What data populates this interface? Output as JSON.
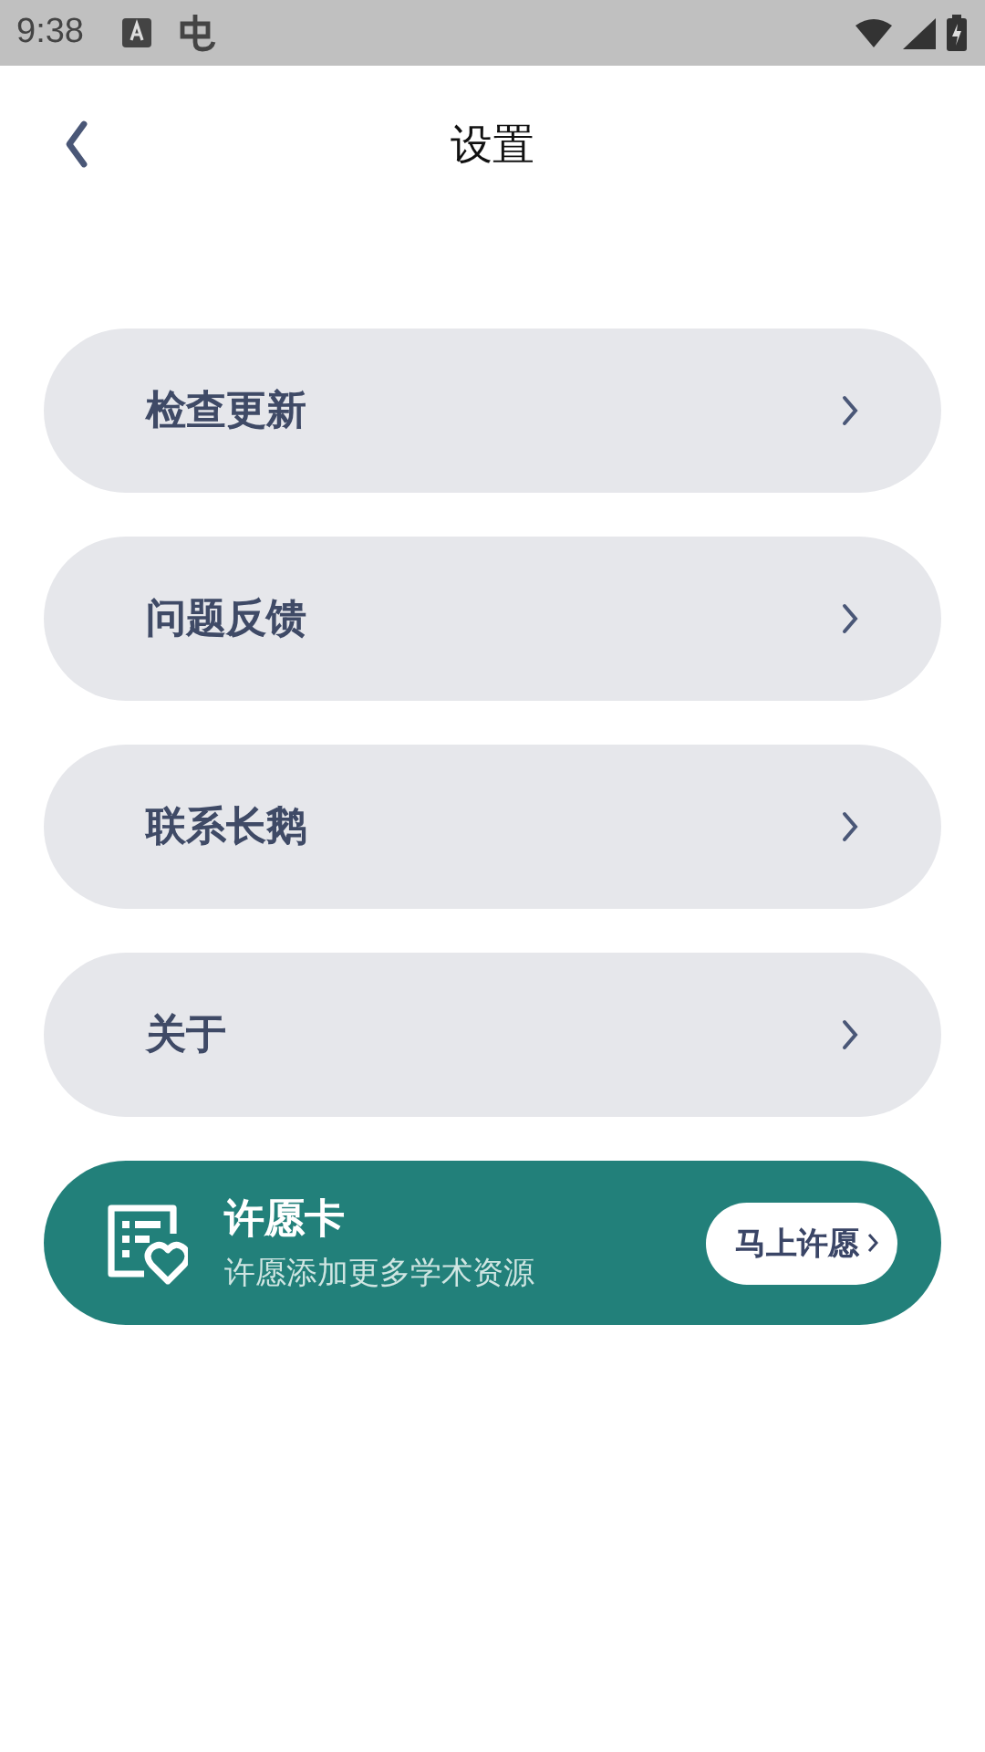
{
  "status_bar": {
    "time": "9:38"
  },
  "header": {
    "title": "设置"
  },
  "menu_items": [
    {
      "label": "检查更新"
    },
    {
      "label": "问题反馈"
    },
    {
      "label": "联系长鹅"
    },
    {
      "label": "关于"
    }
  ],
  "wish_card": {
    "title": "许愿卡",
    "subtitle": "许愿添加更多学术资源",
    "button": "马上许愿"
  }
}
